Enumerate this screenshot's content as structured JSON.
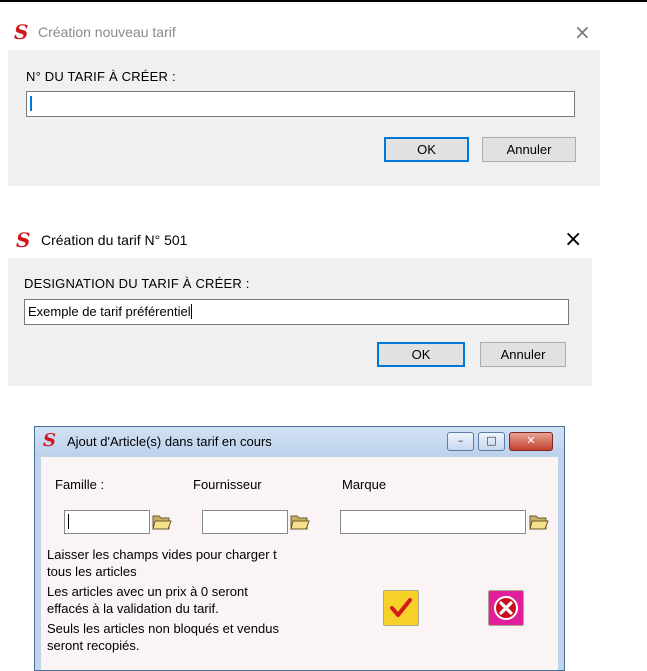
{
  "dialog1": {
    "title": "Création nouveau tarif",
    "field_label": "N° DU TARIF À CRÉER :",
    "field_value": "",
    "ok_label": "OK",
    "cancel_label": "Annuler",
    "close_glyph": "×",
    "logo_letter": "S"
  },
  "dialog2": {
    "title": "Création du tarif N° 501",
    "field_label": "DESIGNATION DU TARIF À CRÉER :",
    "field_value": "Exemple de tarif préférentiel",
    "ok_label": "OK",
    "cancel_label": "Annuler",
    "close_glyph": "×",
    "logo_letter": "S"
  },
  "dialog3": {
    "title": "Ajout d'Article(s) dans tarif en cours",
    "logo_letter": "S",
    "window_controls": {
      "minimize": "–",
      "maximize": "□",
      "close": "✕"
    },
    "fields": [
      {
        "label": "Famille :",
        "value": ""
      },
      {
        "label": "Fournisseur",
        "value": ""
      },
      {
        "label": "Marque",
        "value": ""
      }
    ],
    "notes": [
      "Laisser les champs vides pour charger t",
      "tous les articles",
      "Les articles avec un prix à 0 seront",
      "effacés à la validation du tarif.",
      "Seuls les articles non bloqués et vendus",
      "seront recopiés."
    ],
    "confirm_icon": "checkmark-icon",
    "cancel_icon": "cancel-x-icon"
  },
  "colors": {
    "logo_red": "#d0161b",
    "focus_blue": "#0078d7",
    "win7_frame": "#bfd3ec",
    "client_bg": "#faf4f4",
    "confirm_yellow": "#f7d02a",
    "cancel_pink": "#e0209a"
  }
}
